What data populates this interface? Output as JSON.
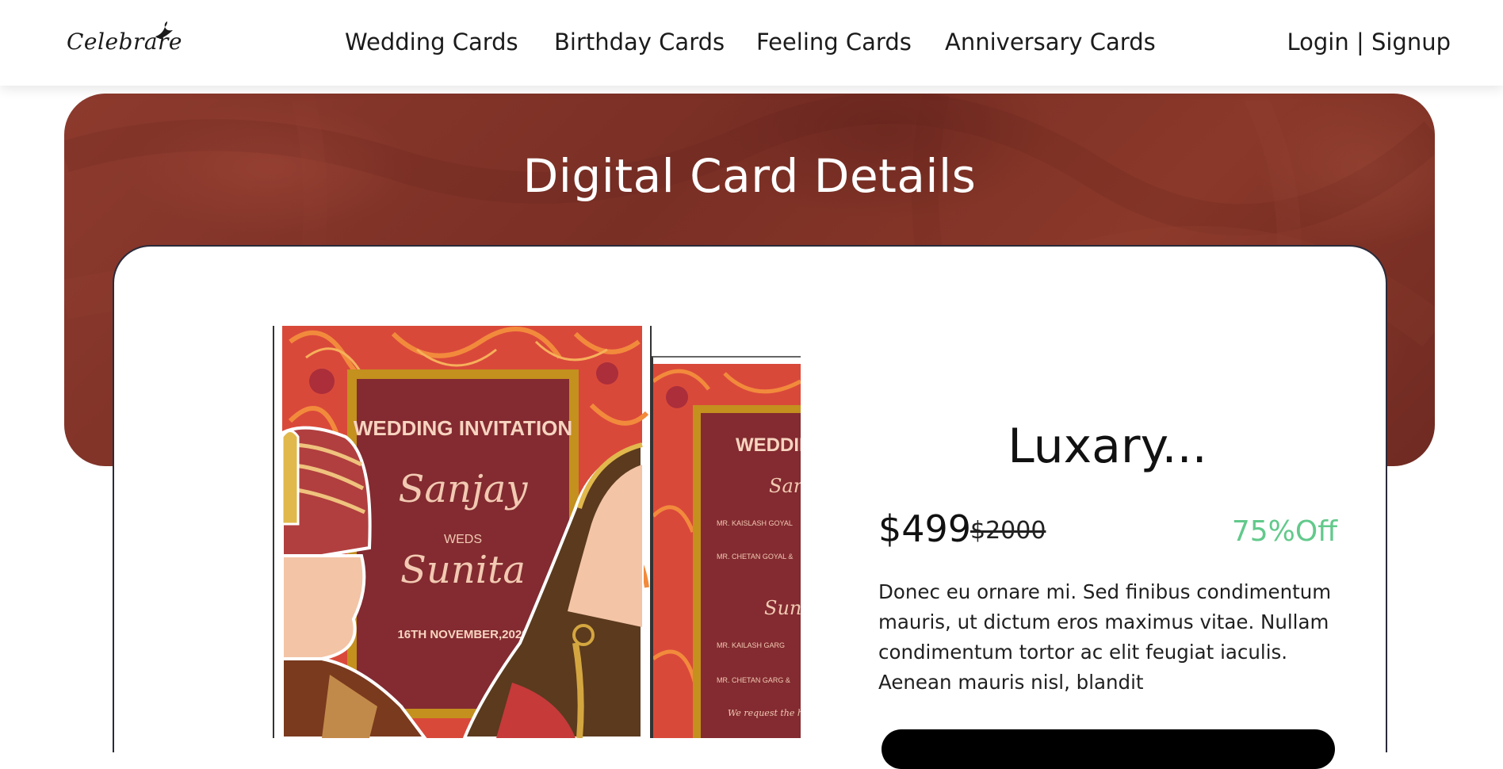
{
  "header": {
    "logo_text": "Celebrare",
    "nav": [
      {
        "label": "Wedding Cards"
      },
      {
        "label": "Birthday Cards"
      },
      {
        "label": "Feeling Cards"
      },
      {
        "label": "Anniversary Cards"
      }
    ],
    "auth": {
      "login": "Login",
      "separator": "|",
      "signup": "Signup"
    }
  },
  "hero": {
    "title": "Digital Card Details"
  },
  "card_image": {
    "heading": "WEDDING INVITATION",
    "groom": "Sanjay",
    "weds": "WEDS",
    "bride": "Sunita",
    "date": "16TH NOVEMBER,2020"
  },
  "card_image_2": {
    "heading": "WEDDING",
    "groom": "Sanjay",
    "line1": "MR. KAISLASH GOYAL",
    "line2": "MR. CHETAN GOYAL &",
    "bride": "Sunita",
    "line3": "MR. KAILASH GARG",
    "line4": "MR. CHETAN GARG &",
    "footer": "We request the honour"
  },
  "product": {
    "title": "Luxary...",
    "price": "$499",
    "old_price": "$2000",
    "discount": "75%Off",
    "description": "Donec eu ornare mi. Sed finibus condimentum mauris, ut dictum eros maximus vitae. Nullam condimentum tortor ac elit feugiat iaculis. Aenean mauris nisl, blandit"
  },
  "colors": {
    "accent_green": "#62c98b",
    "hero_brown": "#7a2f25",
    "invitation_maroon": "#832b31",
    "gold": "#c4901e"
  }
}
